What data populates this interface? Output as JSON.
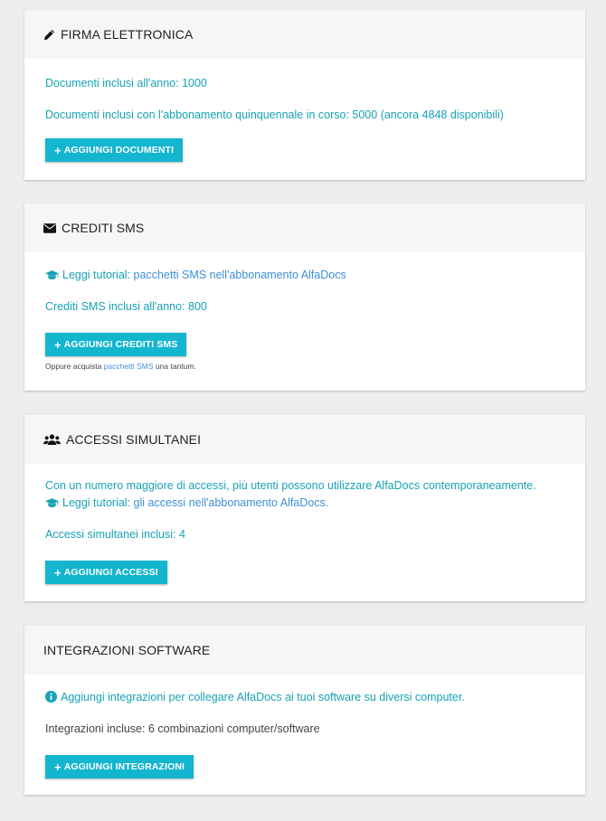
{
  "firma": {
    "title": "FIRMA ELETTRONICA",
    "docs_year": "Documenti inclusi all'anno: 1000",
    "docs_subscription": "Documenti inclusi con l'abbonamento quinquennale in corso: 5000 (ancora 4848 disponibili)",
    "button": "AGGIUNGI DOCUMENTI"
  },
  "sms": {
    "title": "CREDITI SMS",
    "tutorial_prefix": "Leggi tutorial:",
    "tutorial_link": "pacchetti SMS nell'abbonamento AlfaDocs",
    "credits_year": "Crediti SMS inclusi all'anno: 800",
    "button": "AGGIUNGI CREDITI SMS",
    "note_prefix": "Oppure acquista",
    "note_link": "pacchetti SMS",
    "note_suffix": "una tantum."
  },
  "accessi": {
    "title": "ACCESSI SIMULTANEI",
    "description": "Con un numero maggiore di accessi, più utenti possono utilizzare AlfaDocs contemporaneamente.",
    "tutorial_prefix": "Leggi tutorial:",
    "tutorial_link": "gli accessi nell'abbonamento AlfaDocs",
    "tutorial_suffix": ".",
    "included": "Accessi simultanei inclusi: 4",
    "button": "AGGIUNGI ACCESSI"
  },
  "integrazioni": {
    "title": "INTEGRAZIONI SOFTWARE",
    "info": "Aggiungi integrazioni per collegare AlfaDocs ai tuoi software su diversi computer.",
    "included": "Integrazioni incluse: 6 combinazioni computer/software",
    "button": "AGGIUNGI INTEGRAZIONI"
  },
  "colors": {
    "accent": "#13b5cf",
    "text_teal": "#17a2b4",
    "link": "#3d8fd6",
    "background": "#ededed"
  },
  "icons": {
    "firma": "pencil-icon",
    "sms": "envelope-icon",
    "accessi": "users-icon",
    "tutorial": "graduation-cap-icon",
    "info": "info-circle-icon",
    "button": "plus-icon"
  }
}
